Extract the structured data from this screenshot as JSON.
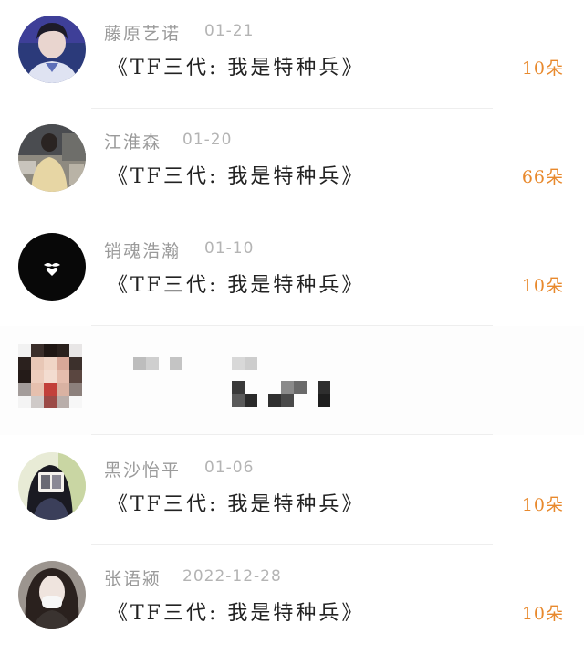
{
  "colors": {
    "name": "#9a9a9a",
    "date": "#b4b4b4",
    "gift": "#222222",
    "count": "#e8892d",
    "divider": "#eeeeee"
  },
  "gift_list": [
    {
      "avatar": "avatar-boy-uniform",
      "name": "藤原艺诺",
      "date": "01-21",
      "gift": "《TF三代:  我是特种兵》",
      "count": "10朵"
    },
    {
      "avatar": "avatar-person-street",
      "name": "江淮森",
      "date": "01-20",
      "gift": "《TF三代:  我是特种兵》",
      "count": "66朵"
    },
    {
      "avatar": "avatar-black-mustache-heart",
      "name": "销魂浩瀚",
      "date": "01-10",
      "gift": "《TF三代:  我是特种兵》",
      "count": "10朵"
    },
    {
      "avatar": "avatar-pixelated",
      "name": "",
      "date": "",
      "gift": "",
      "count": "",
      "redacted": true
    },
    {
      "avatar": "avatar-girl-photo",
      "name": "黑沙怡平",
      "date": "01-06",
      "gift": "《TF三代:  我是特种兵》",
      "count": "10朵"
    },
    {
      "avatar": "avatar-girl-mask",
      "name": "张语颍",
      "date": "2022-12-28",
      "gift": "《TF三代:  我是特种兵》",
      "count": "10朵"
    }
  ]
}
